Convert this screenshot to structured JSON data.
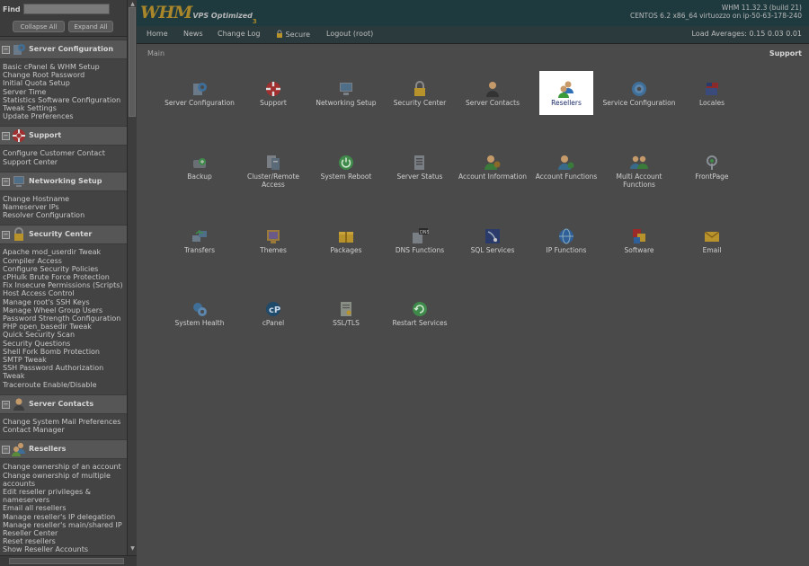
{
  "sidebar": {
    "find_label": "Find",
    "collapse_all": "Collapse All",
    "expand_all": "Expand All",
    "groups": [
      {
        "title": "Server Configuration",
        "icon": "server-config-icon",
        "items": [
          "Basic cPanel & WHM Setup",
          "Change Root Password",
          "Initial Quota Setup",
          "Server Time",
          "Statistics Software Configuration",
          "Tweak Settings",
          "Update Preferences"
        ]
      },
      {
        "title": "Support",
        "icon": "support-icon",
        "items": [
          "Configure Customer Contact",
          "Support Center"
        ]
      },
      {
        "title": "Networking Setup",
        "icon": "networking-icon",
        "items": [
          "Change Hostname",
          "Nameserver IPs",
          "Resolver Configuration"
        ]
      },
      {
        "title": "Security Center",
        "icon": "lock-icon",
        "items": [
          "Apache mod_userdir Tweak",
          "Compiler Access",
          "Configure Security Policies",
          "cPHulk Brute Force Protection",
          "Fix Insecure Permissions (Scripts)",
          "Host Access Control",
          "Manage root's SSH Keys",
          "Manage Wheel Group Users",
          "Password Strength Configuration",
          "PHP open_basedir Tweak",
          "Quick Security Scan",
          "Security Questions",
          "Shell Fork Bomb Protection",
          "SMTP Tweak",
          "SSH Password Authorization Tweak",
          "Traceroute Enable/Disable"
        ]
      },
      {
        "title": "Server Contacts",
        "icon": "contact-icon",
        "items": [
          "Change System Mail Preferences",
          "Contact Manager"
        ]
      },
      {
        "title": "Resellers",
        "icon": "resellers-icon",
        "items": [
          "Change ownership of an account",
          "Change ownership of multiple accounts",
          "Edit reseller privileges & nameservers",
          "Email all resellers",
          "Manage reseller's IP delegation",
          "Manage reseller's main/shared IP",
          "Reseller Center",
          "Reset resellers",
          "Show Reseller Accounts"
        ]
      }
    ]
  },
  "header": {
    "logo_main": "WHM",
    "logo_sub": "VPS Optimized",
    "logo_num": "3",
    "version_line1": "WHM 11.32.3 (build 21)",
    "version_line2": "CENTOS 6.2 x86_64 virtuozzo on ip-50-63-178-240"
  },
  "nav": {
    "home": "Home",
    "news": "News",
    "changelog": "Change Log",
    "secure": "Secure",
    "logout": "Logout (root)",
    "load_averages": "Load Averages: 0.15 0.03 0.01"
  },
  "main": {
    "breadcrumb": "Main",
    "support": "Support",
    "tiles": [
      {
        "label": "Server Configuration",
        "icon": "server-config-icon"
      },
      {
        "label": "Support",
        "icon": "support-icon"
      },
      {
        "label": "Networking Setup",
        "icon": "networking-icon"
      },
      {
        "label": "Security Center",
        "icon": "lock-icon"
      },
      {
        "label": "Server Contacts",
        "icon": "contact-icon"
      },
      {
        "label": "Resellers",
        "icon": "resellers-icon"
      },
      {
        "label": "Service Configuration",
        "icon": "gear-icon"
      },
      {
        "label": "Locales",
        "icon": "flag-icon"
      },
      {
        "label": "Backup",
        "icon": "backup-icon"
      },
      {
        "label": "Cluster/Remote Access",
        "icon": "cluster-icon"
      },
      {
        "label": "System Reboot",
        "icon": "power-icon"
      },
      {
        "label": "Server Status",
        "icon": "server-status-icon"
      },
      {
        "label": "Account Information",
        "icon": "account-info-icon"
      },
      {
        "label": "Account Functions",
        "icon": "account-functions-icon"
      },
      {
        "label": "Multi Account Functions",
        "icon": "multi-account-icon"
      },
      {
        "label": "FrontPage",
        "icon": "frontpage-icon"
      },
      {
        "label": "Transfers",
        "icon": "transfers-icon"
      },
      {
        "label": "Themes",
        "icon": "themes-icon"
      },
      {
        "label": "Packages",
        "icon": "packages-icon"
      },
      {
        "label": "DNS Functions",
        "icon": "dns-icon"
      },
      {
        "label": "SQL Services",
        "icon": "sql-icon"
      },
      {
        "label": "IP Functions",
        "icon": "ip-icon"
      },
      {
        "label": "Software",
        "icon": "software-icon"
      },
      {
        "label": "Email",
        "icon": "email-icon"
      },
      {
        "label": "System Health",
        "icon": "system-health-icon"
      },
      {
        "label": "cPanel",
        "icon": "cpanel-icon"
      },
      {
        "label": "SSL/TLS",
        "icon": "ssl-icon"
      },
      {
        "label": "Restart Services",
        "icon": "restart-icon"
      }
    ]
  },
  "colors": {
    "overlay_bg": "#4a4a4a",
    "header_bg": "#1f3a3f",
    "logo_gold": "#a9862a",
    "highlight": "#ffffff"
  }
}
